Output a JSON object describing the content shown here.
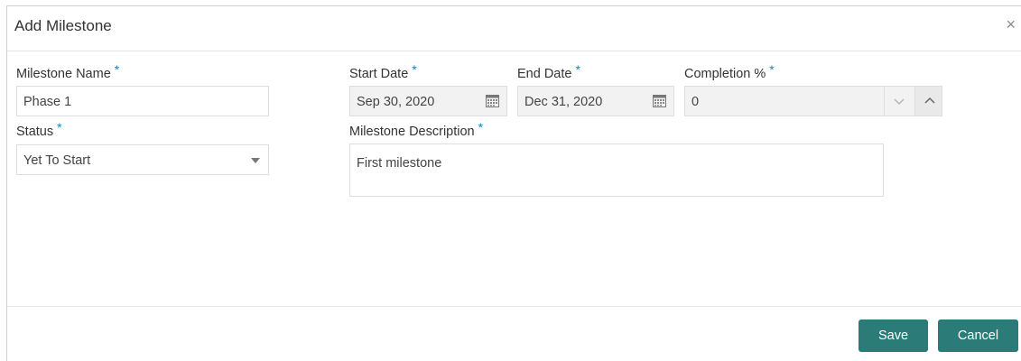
{
  "dialog": {
    "title": "Add Milestone",
    "close_glyph": "×"
  },
  "fields": {
    "milestone_name": {
      "label": "Milestone Name",
      "required": "*",
      "value": "Phase 1"
    },
    "start_date": {
      "label": "Start Date",
      "required": "*",
      "value": "Sep 30, 2020",
      "icon": "calendar-icon"
    },
    "end_date": {
      "label": "End Date",
      "required": "*",
      "value": "Dec 31, 2020",
      "icon": "calendar-icon"
    },
    "completion": {
      "label": "Completion %",
      "required": "*",
      "value": "0"
    },
    "status": {
      "label": "Status",
      "required": "*",
      "value": "Yet To Start"
    },
    "description": {
      "label": "Milestone Description",
      "required": "*",
      "value": "First milestone"
    }
  },
  "footer": {
    "save_label": "Save",
    "cancel_label": "Cancel"
  },
  "colors": {
    "accent": "#2b7b78",
    "required": "#1e7fb5"
  }
}
